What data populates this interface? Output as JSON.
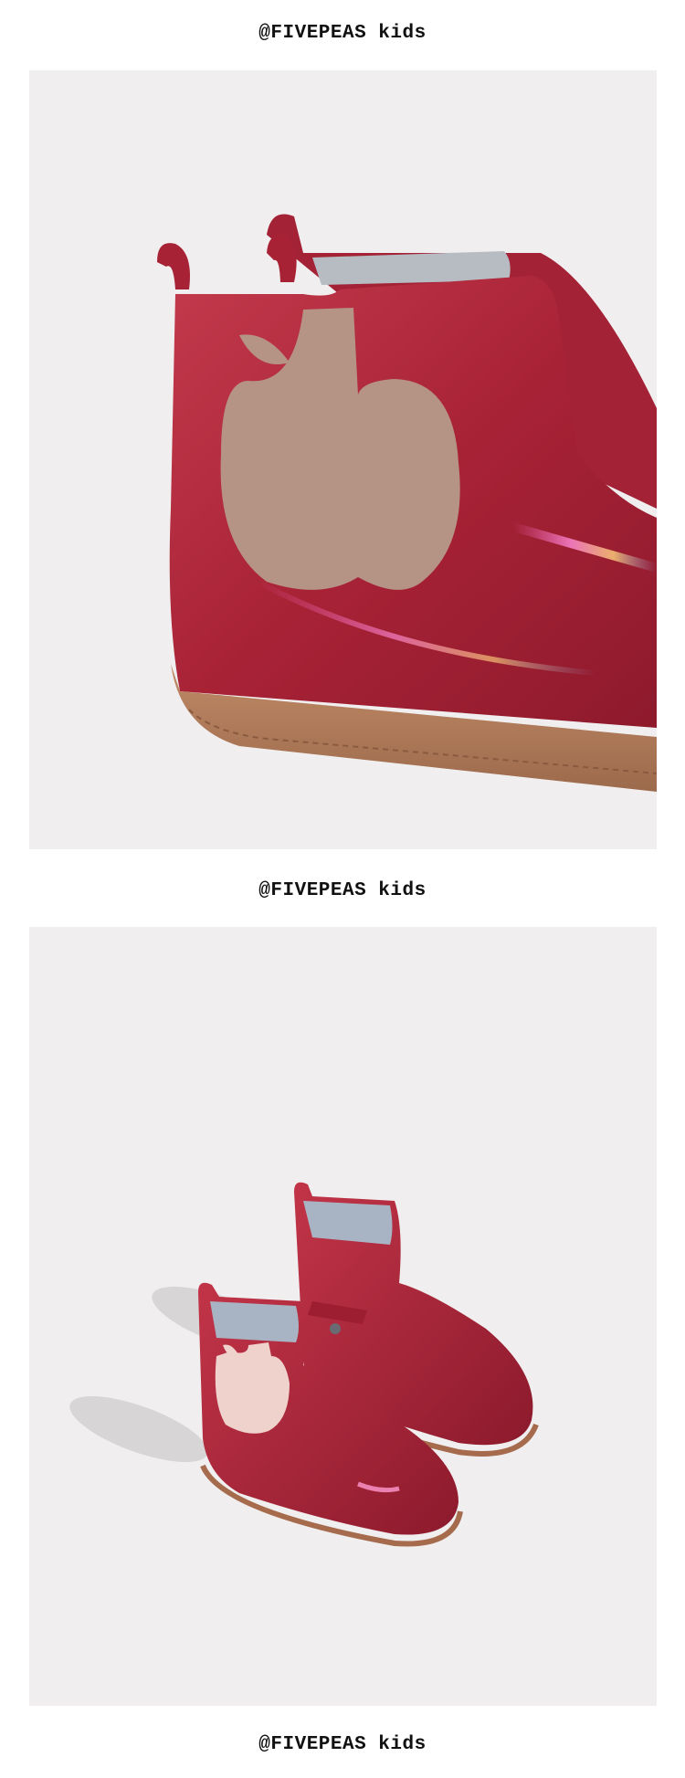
{
  "captions": [
    {
      "text": "@FIVEPEAS kids"
    },
    {
      "text": "@FIVEPEAS kids"
    },
    {
      "text": "@FIVEPEAS kids"
    }
  ],
  "photos": [
    {
      "alt": "red patent leather boot with apple-shaped elastic panel, close-up"
    },
    {
      "alt": "pair of red patent leather toddler boots with apple detail"
    }
  ],
  "colors": {
    "background": "#f0eeef",
    "boot_red": "#b0283c",
    "sole": "#b07a5a",
    "apple_panel": "#b69485"
  }
}
